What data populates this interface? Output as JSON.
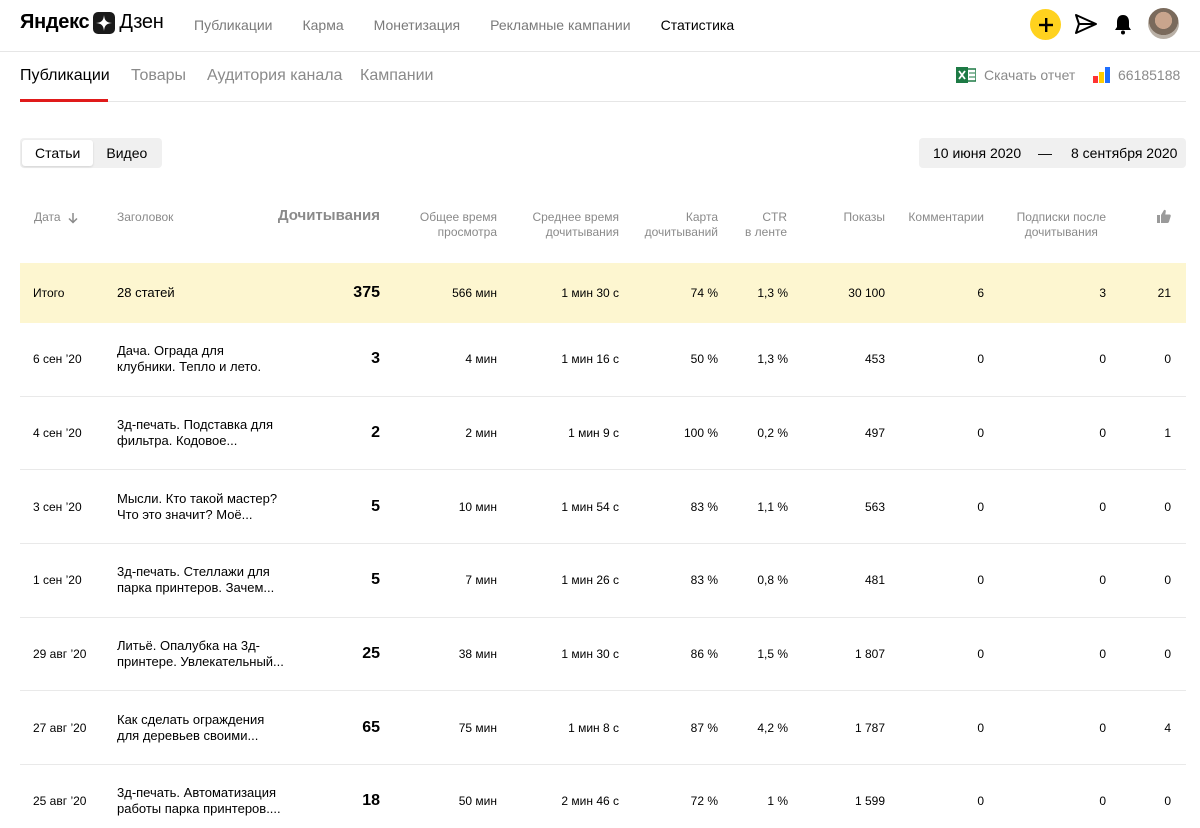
{
  "header": {
    "logo_part1": "Яндекс",
    "logo_part2": "Дзен",
    "nav": [
      "Публикации",
      "Карма",
      "Монетизация",
      "Рекламные кампании",
      "Статистика"
    ],
    "active_nav_index": 4,
    "icons": [
      "plus-icon",
      "send-icon",
      "bell-icon",
      "avatar"
    ],
    "accent_color": "#ffd21e"
  },
  "subtabs": {
    "items": [
      "Публикации",
      "Товары",
      "Аудитория канала",
      "Кампании"
    ],
    "active_index": 0,
    "download_label": "Скачать отчет",
    "counter": "66185188"
  },
  "filters": {
    "segments": [
      "Статьи",
      "Видео"
    ],
    "active_segment": 0,
    "date_from": "10 июня 2020",
    "date_sep": "—",
    "date_to": "8 сентября 2020"
  },
  "table": {
    "headers": {
      "date": "Дата",
      "title": "Заголовок",
      "reads": "Дочитывания",
      "total_time_1": "Общее время",
      "total_time_2": "просмотра",
      "avg_time_1": "Среднее время",
      "avg_time_2": "дочитывания",
      "card_1": "Карта",
      "card_2": "дочитываний",
      "ctr_1": "CTR",
      "ctr_2": "в ленте",
      "shows": "Показы",
      "comments": "Комментарии",
      "subs_1": "Подписки после",
      "subs_2": "дочитывания"
    },
    "total": {
      "date": "Итого",
      "title": "28 статей",
      "reads": "375",
      "total_time": "566 мин",
      "avg_time": "1 мин 30 с",
      "card": "74 %",
      "ctr": "1,3 %",
      "shows": "30 100",
      "comments": "6",
      "subs": "3",
      "likes": "21"
    },
    "rows": [
      {
        "date": "6 сен ’20",
        "title_1": "Дача. Ограда для",
        "title_2": "клубники. Тепло и лето.",
        "reads": "3",
        "total_time": "4 мин",
        "avg_time": "1 мин 16 с",
        "card": "50 %",
        "ctr": "1,3 %",
        "shows": "453",
        "comments": "0",
        "subs": "0",
        "likes": "0"
      },
      {
        "date": "4 сен ’20",
        "title_1": "3д-печать. Подставка для",
        "title_2": "фильтра. Кодовое...",
        "reads": "2",
        "total_time": "2 мин",
        "avg_time": "1 мин 9 с",
        "card": "100 %",
        "ctr": "0,2 %",
        "shows": "497",
        "comments": "0",
        "subs": "0",
        "likes": "1"
      },
      {
        "date": "3 сен ’20",
        "title_1": "Мысли. Кто такой мастер?",
        "title_2": "Что это значит? Моё...",
        "reads": "5",
        "total_time": "10 мин",
        "avg_time": "1 мин 54 с",
        "card": "83 %",
        "ctr": "1,1 %",
        "shows": "563",
        "comments": "0",
        "subs": "0",
        "likes": "0"
      },
      {
        "date": "1 сен ’20",
        "title_1": "3д-печать. Стеллажи для",
        "title_2": "парка принтеров. Зачем...",
        "reads": "5",
        "total_time": "7 мин",
        "avg_time": "1 мин 26 с",
        "card": "83 %",
        "ctr": "0,8 %",
        "shows": "481",
        "comments": "0",
        "subs": "0",
        "likes": "0"
      },
      {
        "date": "29 авг ’20",
        "title_1": "Литьё. Опалубка на 3д-",
        "title_2": "принтере. Увлекательный...",
        "reads": "25",
        "total_time": "38 мин",
        "avg_time": "1 мин 30 с",
        "card": "86 %",
        "ctr": "1,5 %",
        "shows": "1 807",
        "comments": "0",
        "subs": "0",
        "likes": "0"
      },
      {
        "date": "27 авг ’20",
        "title_1": "Как сделать ограждения",
        "title_2": "для деревьев своими...",
        "reads": "65",
        "total_time": "75 мин",
        "avg_time": "1 мин 8 с",
        "card": "87 %",
        "ctr": "4,2 %",
        "shows": "1 787",
        "comments": "0",
        "subs": "0",
        "likes": "4"
      },
      {
        "date": "25 авг ’20",
        "title_1": "3д-печать. Автоматизация",
        "title_2": "работы парка принтеров....",
        "reads": "18",
        "total_time": "50 мин",
        "avg_time": "2 мин 46 с",
        "card": "72 %",
        "ctr": "1 %",
        "shows": "1 599",
        "comments": "0",
        "subs": "0",
        "likes": "0"
      }
    ]
  }
}
